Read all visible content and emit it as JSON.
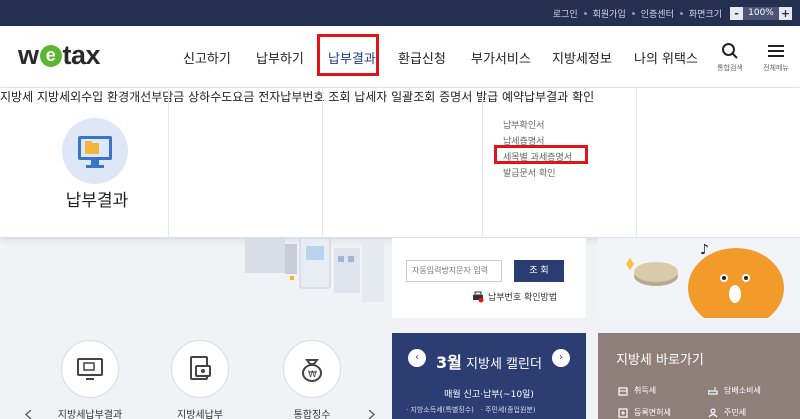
{
  "topbar": {
    "links": [
      "로그인",
      "회원가입",
      "인증센터",
      "화면크기"
    ],
    "zoom_minus": "-",
    "zoom_value": "100%",
    "zoom_plus": "+"
  },
  "header": {
    "logo_prefix": "w",
    "logo_e": "e",
    "logo_suffix": "tax",
    "gnb": [
      "신고하기",
      "납부하기",
      "납부결과",
      "환급신청",
      "부가서비스",
      "지방세정보",
      "나의 위택스"
    ],
    "search_caption": "통합검색",
    "allmenu_caption": "전체메뉴"
  },
  "mega": {
    "category_title": "납부결과",
    "col1": [
      "지방세",
      "지방세외수입",
      "환경개선부담금",
      "상하수도요금"
    ],
    "col2": [
      "전자납부번호 조회",
      "납세자 일괄조회"
    ],
    "col3_title": "증명서 발급",
    "col3_subs": [
      "납부확인서",
      "납세증명서",
      "세목별 과세증명서",
      "발급문서 확인"
    ],
    "col4": [
      "예약납부결과 확인"
    ]
  },
  "login": {
    "captcha_placeholder": "자동입력방지문자 입력",
    "captcha_button": "조 회",
    "payno_link": "납부번호 확인방법"
  },
  "quick": {
    "items": [
      "지방세납부결과",
      "지방세납부",
      "통합징수"
    ]
  },
  "calendar": {
    "month": "3월",
    "title": "지방세 캘린더",
    "prev": "‹",
    "next": "›",
    "sub": "매월 신고·납부(~10일)",
    "items": [
      "지방소득세(특별징수)",
      "주민세(종업원분)"
    ]
  },
  "shortcut": {
    "title": "지방세 바로가기",
    "items": [
      "취득세",
      "담배소비세",
      "등록면허세",
      "주민세"
    ]
  },
  "colors": {
    "topbar": "#253050",
    "highlight": "#e0151a",
    "navy": "#2b3d73",
    "brand_green": "#5cb531"
  }
}
